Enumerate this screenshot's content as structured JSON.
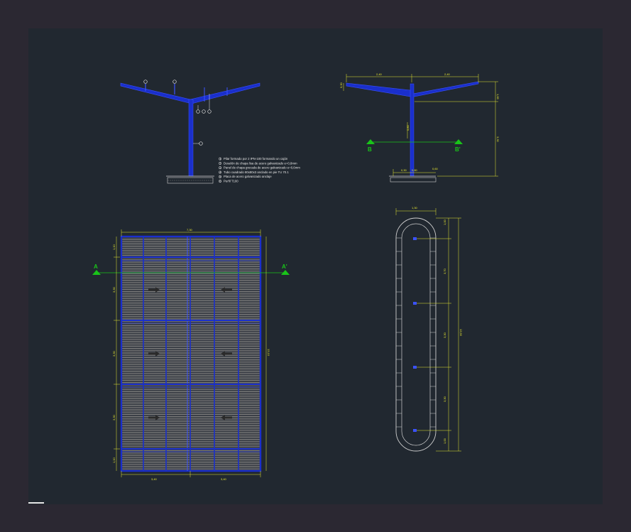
{
  "canvas": {
    "background": "#212830",
    "frame": "#2b2832"
  },
  "colors": {
    "structure": "#1a2fcc",
    "dimension": "#e8e830",
    "section": "#19c419",
    "note": "#e6e6e6",
    "panel": "#6a6a6a"
  },
  "elevation_a": {
    "legend": [
      {
        "num": "1",
        "text": "Pilar formado por 2 IPN-100 formando un cajón"
      },
      {
        "num": "2",
        "text": "Doselón de chapa lisa de acero galvanizado e=0,8mm"
      },
      {
        "num": "3",
        "text": "Panel de chapa grecada de acero galvanizado e=0,6mm"
      },
      {
        "num": "4",
        "text": "Tubo cuadrado 80x80x3 anclado en pie TU 70.1"
      },
      {
        "num": "5",
        "text": "Placa de acero galvanizado anclaje"
      },
      {
        "num": "6",
        "text": "Perfil T100"
      }
    ]
  },
  "section_b": {
    "dims": {
      "left_span": "2,40",
      "right_span": "2,40",
      "top_right": "1,65",
      "height": "3,30",
      "pillar": "0,80",
      "base_left": "0,30",
      "base_mid": "0,80",
      "base_right": "0,60",
      "side_left": "0,30"
    },
    "marks": {
      "b_left": "B",
      "b_right": "B'"
    }
  },
  "plan": {
    "dims": {
      "top_width": "7,30",
      "bottom_left": "3,40",
      "bottom_right": "3,40",
      "total_height": "13,10",
      "row_1": "1,10",
      "row_2": "3,30",
      "row_3": "3,30",
      "row_4": "3,30",
      "row_5": "1,10"
    },
    "marks": {
      "a_left": "A",
      "a_right": "A'"
    }
  },
  "base_plan": {
    "dims": {
      "top_width": "1,30",
      "seg_1": "1,00",
      "seg_2": "3,70",
      "seg_3": "3,30",
      "seg_4": "3,30",
      "seg_5": "1,00",
      "total": "13,90"
    }
  }
}
